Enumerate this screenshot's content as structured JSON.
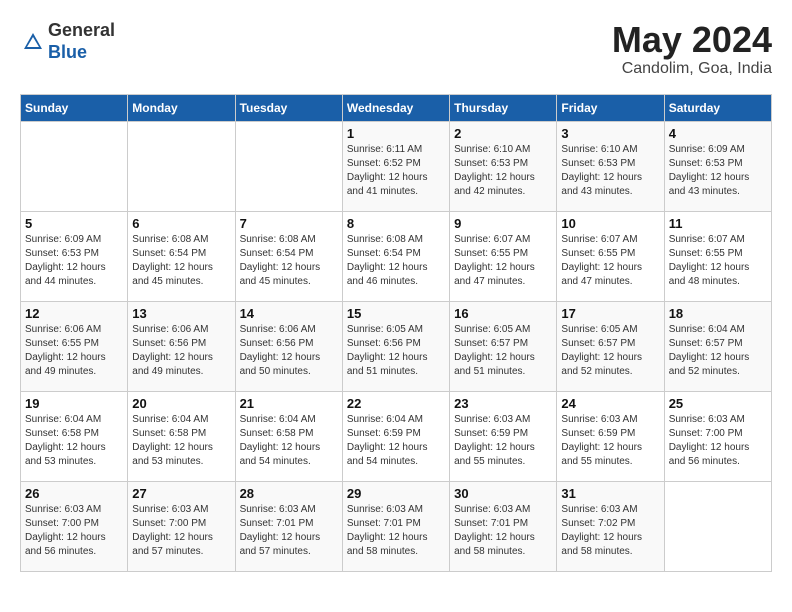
{
  "header": {
    "logo_line1": "General",
    "logo_line2": "Blue",
    "title": "May 2024",
    "subtitle": "Candolim, Goa, India"
  },
  "weekdays": [
    "Sunday",
    "Monday",
    "Tuesday",
    "Wednesday",
    "Thursday",
    "Friday",
    "Saturday"
  ],
  "weeks": [
    [
      {
        "day": "",
        "info": ""
      },
      {
        "day": "",
        "info": ""
      },
      {
        "day": "",
        "info": ""
      },
      {
        "day": "1",
        "info": "Sunrise: 6:11 AM\nSunset: 6:52 PM\nDaylight: 12 hours\nand 41 minutes."
      },
      {
        "day": "2",
        "info": "Sunrise: 6:10 AM\nSunset: 6:53 PM\nDaylight: 12 hours\nand 42 minutes."
      },
      {
        "day": "3",
        "info": "Sunrise: 6:10 AM\nSunset: 6:53 PM\nDaylight: 12 hours\nand 43 minutes."
      },
      {
        "day": "4",
        "info": "Sunrise: 6:09 AM\nSunset: 6:53 PM\nDaylight: 12 hours\nand 43 minutes."
      }
    ],
    [
      {
        "day": "5",
        "info": "Sunrise: 6:09 AM\nSunset: 6:53 PM\nDaylight: 12 hours\nand 44 minutes."
      },
      {
        "day": "6",
        "info": "Sunrise: 6:08 AM\nSunset: 6:54 PM\nDaylight: 12 hours\nand 45 minutes."
      },
      {
        "day": "7",
        "info": "Sunrise: 6:08 AM\nSunset: 6:54 PM\nDaylight: 12 hours\nand 45 minutes."
      },
      {
        "day": "8",
        "info": "Sunrise: 6:08 AM\nSunset: 6:54 PM\nDaylight: 12 hours\nand 46 minutes."
      },
      {
        "day": "9",
        "info": "Sunrise: 6:07 AM\nSunset: 6:55 PM\nDaylight: 12 hours\nand 47 minutes."
      },
      {
        "day": "10",
        "info": "Sunrise: 6:07 AM\nSunset: 6:55 PM\nDaylight: 12 hours\nand 47 minutes."
      },
      {
        "day": "11",
        "info": "Sunrise: 6:07 AM\nSunset: 6:55 PM\nDaylight: 12 hours\nand 48 minutes."
      }
    ],
    [
      {
        "day": "12",
        "info": "Sunrise: 6:06 AM\nSunset: 6:55 PM\nDaylight: 12 hours\nand 49 minutes."
      },
      {
        "day": "13",
        "info": "Sunrise: 6:06 AM\nSunset: 6:56 PM\nDaylight: 12 hours\nand 49 minutes."
      },
      {
        "day": "14",
        "info": "Sunrise: 6:06 AM\nSunset: 6:56 PM\nDaylight: 12 hours\nand 50 minutes."
      },
      {
        "day": "15",
        "info": "Sunrise: 6:05 AM\nSunset: 6:56 PM\nDaylight: 12 hours\nand 51 minutes."
      },
      {
        "day": "16",
        "info": "Sunrise: 6:05 AM\nSunset: 6:57 PM\nDaylight: 12 hours\nand 51 minutes."
      },
      {
        "day": "17",
        "info": "Sunrise: 6:05 AM\nSunset: 6:57 PM\nDaylight: 12 hours\nand 52 minutes."
      },
      {
        "day": "18",
        "info": "Sunrise: 6:04 AM\nSunset: 6:57 PM\nDaylight: 12 hours\nand 52 minutes."
      }
    ],
    [
      {
        "day": "19",
        "info": "Sunrise: 6:04 AM\nSunset: 6:58 PM\nDaylight: 12 hours\nand 53 minutes."
      },
      {
        "day": "20",
        "info": "Sunrise: 6:04 AM\nSunset: 6:58 PM\nDaylight: 12 hours\nand 53 minutes."
      },
      {
        "day": "21",
        "info": "Sunrise: 6:04 AM\nSunset: 6:58 PM\nDaylight: 12 hours\nand 54 minutes."
      },
      {
        "day": "22",
        "info": "Sunrise: 6:04 AM\nSunset: 6:59 PM\nDaylight: 12 hours\nand 54 minutes."
      },
      {
        "day": "23",
        "info": "Sunrise: 6:03 AM\nSunset: 6:59 PM\nDaylight: 12 hours\nand 55 minutes."
      },
      {
        "day": "24",
        "info": "Sunrise: 6:03 AM\nSunset: 6:59 PM\nDaylight: 12 hours\nand 55 minutes."
      },
      {
        "day": "25",
        "info": "Sunrise: 6:03 AM\nSunset: 7:00 PM\nDaylight: 12 hours\nand 56 minutes."
      }
    ],
    [
      {
        "day": "26",
        "info": "Sunrise: 6:03 AM\nSunset: 7:00 PM\nDaylight: 12 hours\nand 56 minutes."
      },
      {
        "day": "27",
        "info": "Sunrise: 6:03 AM\nSunset: 7:00 PM\nDaylight: 12 hours\nand 57 minutes."
      },
      {
        "day": "28",
        "info": "Sunrise: 6:03 AM\nSunset: 7:01 PM\nDaylight: 12 hours\nand 57 minutes."
      },
      {
        "day": "29",
        "info": "Sunrise: 6:03 AM\nSunset: 7:01 PM\nDaylight: 12 hours\nand 58 minutes."
      },
      {
        "day": "30",
        "info": "Sunrise: 6:03 AM\nSunset: 7:01 PM\nDaylight: 12 hours\nand 58 minutes."
      },
      {
        "day": "31",
        "info": "Sunrise: 6:03 AM\nSunset: 7:02 PM\nDaylight: 12 hours\nand 58 minutes."
      },
      {
        "day": "",
        "info": ""
      }
    ]
  ]
}
